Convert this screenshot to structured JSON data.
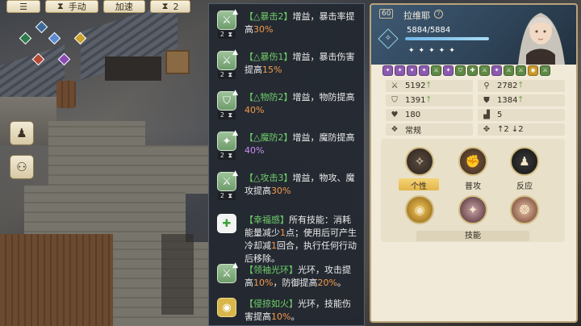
{
  "top_bar": {
    "auto_label": "手动",
    "speed_label": "加速",
    "turn_count": "2"
  },
  "buffs": [
    {
      "tag": "【△暴击2】",
      "text": "增益，暴击率提高",
      "value": "30%",
      "color": "orange",
      "turns": "2"
    },
    {
      "tag": "【△暴伤1】",
      "text": "增益，暴击伤害提高",
      "value": "15%",
      "color": "orange",
      "turns": "2"
    },
    {
      "tag": "【△物防2】",
      "text": "增益，物防提高",
      "value": "40%",
      "color": "orange",
      "turns": "2"
    },
    {
      "tag": "【△魔防2】",
      "text": "增益，魔防提高",
      "value": "40%",
      "color": "purple",
      "turns": "2"
    },
    {
      "tag": "【△攻击3】",
      "text": "增益，物攻、魔攻提高",
      "value": "30%",
      "color": "orange",
      "turns": "2"
    },
    {
      "tag": "【幸福感】",
      "text_a": "所有技能：消耗能量减少",
      "value": "1",
      "text_b": "点；使用后可产生冷却减",
      "value2": "1",
      "text_c": "回合，执行任何行动后移除。"
    },
    {
      "tag": "【领袖光环】",
      "text_a": "光环，攻击提高",
      "value": "10%",
      "text_b": "，防御提高",
      "value2": "20%",
      "text_c": "。"
    },
    {
      "tag": "【侵掠如火】",
      "text_a": "光环，技能伤害提高",
      "value": "10%",
      "text_c": "。"
    }
  ],
  "character": {
    "level": "60",
    "name": "拉维耶",
    "hp_text": "5884/5884",
    "hp_fraction": 1.0,
    "star_count": 5,
    "stats": [
      {
        "left_icon": "sword-icon",
        "left": "5192",
        "right_icon": "staff-icon",
        "right": "2782"
      },
      {
        "left_icon": "shield-icon",
        "left": "1391",
        "right_icon": "magic-shield-icon",
        "right": "1384"
      },
      {
        "left_icon": "heart-icon",
        "left": "180",
        "right_icon": "boot-icon",
        "right": "5"
      },
      {
        "left_icon": "element-icon",
        "left": "常规",
        "right_icon": "range-icon",
        "right": "↑2 ↓2"
      }
    ],
    "skills": {
      "personality_label": "个性",
      "normal_attack_label": "普攻",
      "counter_label": "反应",
      "section_label": "技能"
    }
  },
  "colors": {
    "buff_tag": "#6fd06a",
    "orange_value": "#f39a4a",
    "purple_value": "#c98ff1",
    "panel_bg": "#f1ead8"
  }
}
